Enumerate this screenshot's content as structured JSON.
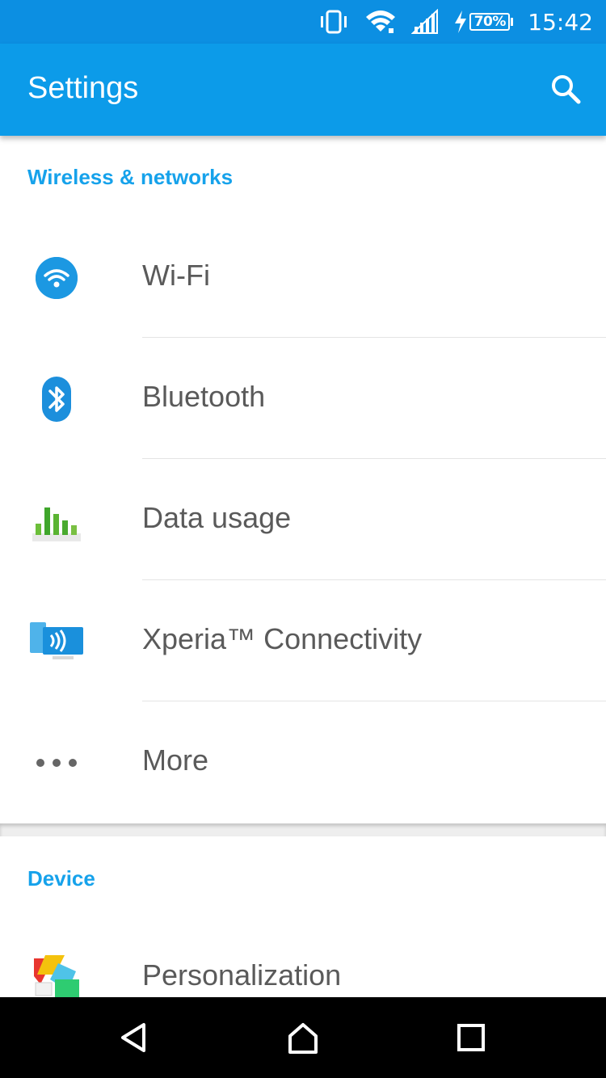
{
  "status_bar": {
    "battery_level": "70%",
    "time": "15:42",
    "icons": [
      "vibrate-icon",
      "wifi-signal-icon",
      "cell-signal-icon",
      "charging-icon",
      "battery-icon"
    ]
  },
  "app_bar": {
    "title": "Settings",
    "search_icon": "search-icon"
  },
  "sections": [
    {
      "header": "Wireless & networks",
      "items": [
        {
          "label": "Wi-Fi",
          "icon": "wifi-icon"
        },
        {
          "label": "Bluetooth",
          "icon": "bluetooth-icon"
        },
        {
          "label": "Data usage",
          "icon": "data-usage-icon"
        },
        {
          "label": "Xperia™ Connectivity",
          "icon": "xperia-connectivity-icon"
        },
        {
          "label": "More",
          "icon": "more-icon"
        }
      ]
    },
    {
      "header": "Device",
      "items": [
        {
          "label": "Personalization",
          "icon": "personalization-icon"
        }
      ]
    }
  ],
  "nav_bar": {
    "buttons": [
      "back-icon",
      "home-icon",
      "recents-icon"
    ]
  },
  "colors": {
    "status_bar": "#0c8fe2",
    "app_bar": "#0c9be9",
    "accent": "#16a2eb",
    "label_text": "#5a5a5a",
    "nav_bar": "#000000"
  }
}
